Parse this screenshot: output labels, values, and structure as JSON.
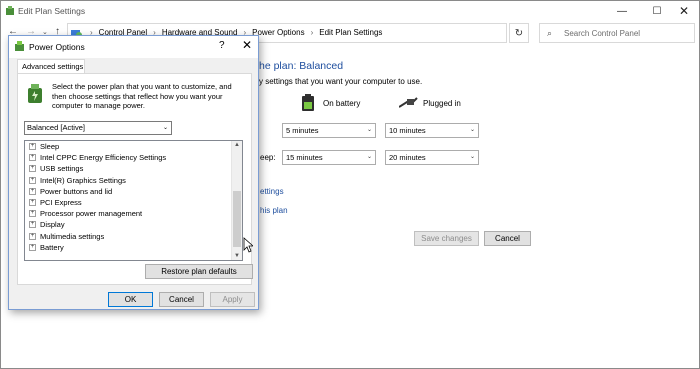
{
  "window": {
    "title": "Edit Plan Settings",
    "controls": {
      "minimize": "—",
      "maximize": "☐",
      "close": "✕"
    }
  },
  "address_bar": {
    "back": "←",
    "forward": "→",
    "recent": "⌄",
    "up": "↑",
    "crumb_sep": "›",
    "breadcrumbs": [
      "Control Panel",
      "Hardware and Sound",
      "Power Options",
      "Edit Plan Settings"
    ],
    "dropdown": "⌄",
    "refresh": "↻"
  },
  "search": {
    "placeholder": "Search Control Panel",
    "icon": "⌕"
  },
  "background": {
    "heading": "he plan: Balanced",
    "subtext": "y settings that you want your computer to use.",
    "col_battery": "On battery",
    "col_plugged": "Plugged in",
    "row2_label": "eep:",
    "select_r1_battery": "5 minutes",
    "select_r1_plugged": "10 minutes",
    "select_r2_battery": "15 minutes",
    "select_r2_plugged": "20 minutes",
    "link_settings": "ettings",
    "link_plan": "his plan",
    "save_button": "Save changes",
    "cancel_button": "Cancel"
  },
  "dialog": {
    "title": "Power Options",
    "help": "?",
    "close": "✕",
    "tab": "Advanced settings",
    "description": "Select the power plan that you want to customize, and then choose settings that reflect how you want your computer to manage power.",
    "plan_select": "Balanced [Active]",
    "caret": "⌄",
    "expander": "+",
    "tree_items": [
      "Sleep",
      "Intel CPPC Energy Efficiency Settings",
      "USB settings",
      "Intel(R) Graphics Settings",
      "Power buttons and lid",
      "PCI Express",
      "Processor power management",
      "Display",
      "Multimedia settings",
      "Battery"
    ],
    "scroll_up": "▲",
    "scroll_down": "▼",
    "restore_button": "Restore plan defaults",
    "ok_button": "OK",
    "cancel_button": "Cancel",
    "apply_button": "Apply"
  },
  "colors": {
    "link_blue": "#1e4e9e",
    "dialog_bg": "#f0f0f0",
    "focus_border": "#0078d7"
  }
}
